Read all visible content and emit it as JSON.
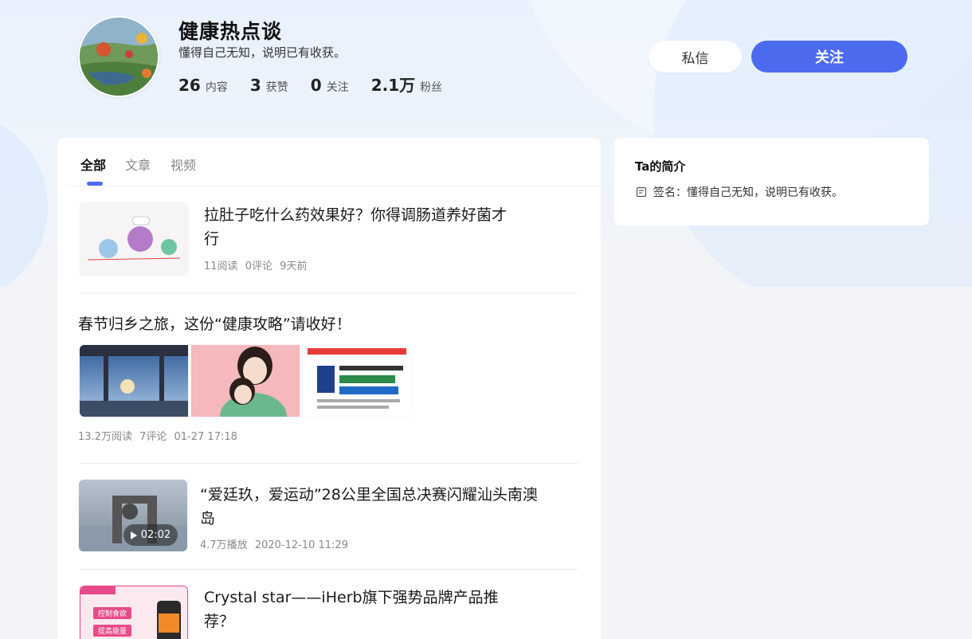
{
  "profile": {
    "name": "健康热点谈",
    "bio": "懂得自己无知，说明已有收获。",
    "stats": [
      {
        "num": "26",
        "label": "内容"
      },
      {
        "num": "3",
        "label": "获赞"
      },
      {
        "num": "0",
        "label": "关注"
      },
      {
        "num": "2.1万",
        "label": "粉丝"
      }
    ]
  },
  "actions": {
    "message": "私信",
    "follow": "关注"
  },
  "tabs": [
    {
      "label": "全部"
    },
    {
      "label": "文章"
    },
    {
      "label": "视频"
    }
  ],
  "feed": [
    {
      "title_line1": "拉肚子吃什么药效果好？你得调肠道养好菌才",
      "title_line2": "行",
      "meta": [
        "11阅读",
        "0评论",
        "9天前"
      ]
    },
    {
      "title": "春节归乡之旅，这份“健康攻略”请收好！",
      "meta": [
        "13.2万阅读",
        "7评论",
        "01-27 17:18"
      ]
    },
    {
      "title_line1": "“爱廷玖，爱运动”28公里全国总决赛闪耀汕头南澳",
      "title_line2": "岛",
      "duration": "02:02",
      "meta": [
        "4.7万播放",
        "2020-12-10 11:29"
      ]
    },
    {
      "title_line1": "Crystal star——iHerb旗下强势品牌产品推",
      "title_line2": "荐？",
      "thumb_tags": [
        "控制食欲",
        "提高能量"
      ]
    }
  ],
  "sidebar": {
    "title": "Ta的简介",
    "signature": "签名：懂得自己无知，说明已有收获。"
  },
  "colors": {
    "accent": "#4d6bef"
  }
}
